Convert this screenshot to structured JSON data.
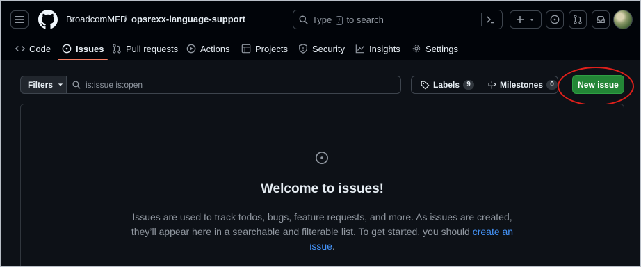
{
  "repo": {
    "owner": "BroadcomMFD",
    "separator": "/",
    "name": "opsrexx-language-support"
  },
  "search": {
    "placeholder_before": "Type",
    "key": "/",
    "placeholder_after": "to search"
  },
  "tabs": [
    {
      "label": "Code",
      "icon": "code-icon"
    },
    {
      "label": "Issues",
      "icon": "issue-opened-icon",
      "active": true
    },
    {
      "label": "Pull requests",
      "icon": "git-pull-request-icon"
    },
    {
      "label": "Actions",
      "icon": "play-icon"
    },
    {
      "label": "Projects",
      "icon": "table-icon"
    },
    {
      "label": "Security",
      "icon": "shield-icon"
    },
    {
      "label": "Insights",
      "icon": "graph-icon"
    },
    {
      "label": "Settings",
      "icon": "gear-icon"
    }
  ],
  "toolbar": {
    "filters_label": "Filters",
    "filter_value": "is:issue is:open",
    "labels_label": "Labels",
    "labels_count": "9",
    "milestones_label": "Milestones",
    "milestones_count": "0",
    "new_issue_label": "New issue"
  },
  "blankslate": {
    "title": "Welcome to issues!",
    "text": "Issues are used to track todos, bugs, feature requests, and more. As issues are created, they’ll appear here in a searchable and filterable list. To get started, you should",
    "link": "create an issue",
    "end": "."
  },
  "colors": {
    "accent_tab": "#f78166",
    "primary_button": "#238636",
    "annotation": "#e0201b",
    "link": "#4493f8"
  }
}
